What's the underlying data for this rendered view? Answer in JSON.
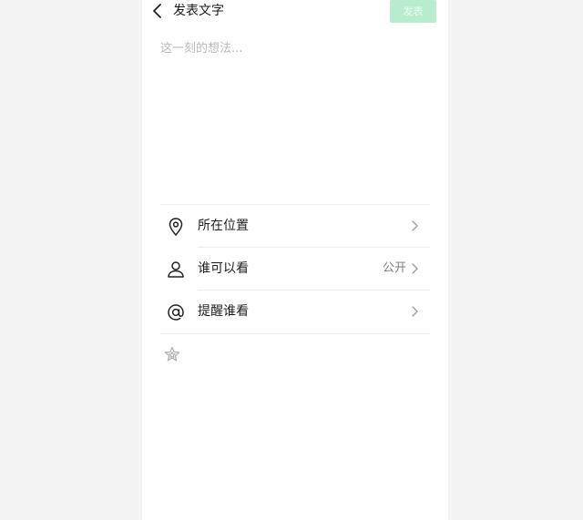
{
  "header": {
    "back_icon": "chevron-left-icon",
    "title": "发表文字",
    "publish_label": "发表"
  },
  "composer": {
    "placeholder": "这一刻的想法..."
  },
  "options": [
    {
      "icon": "location-pin-icon",
      "label": "所在位置",
      "value": ""
    },
    {
      "icon": "person-icon",
      "label": "谁可以看",
      "value": "公开"
    },
    {
      "icon": "at-sign-icon",
      "label": "提醒谁看",
      "value": ""
    }
  ],
  "extras": {
    "star_icon": "star-icon"
  },
  "colors": {
    "publish_bg": "#b9ecce",
    "background": "#f3f3f3",
    "panel": "#ffffff"
  }
}
